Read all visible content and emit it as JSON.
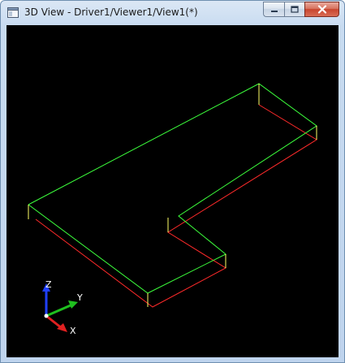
{
  "window": {
    "title": "3D View - Driver1/Viewer1/View1(*)",
    "buttons": [
      "minimize",
      "maximize",
      "close"
    ]
  },
  "viewport": {
    "background": "#000000",
    "edge_colors": {
      "top": "#3cff3c",
      "bottom": "#ff2a2a",
      "vertical": "#ffff66"
    }
  },
  "axis_triad": {
    "z_label": "Z",
    "y_label": "Y",
    "x_label": "X",
    "z_color": "#1f3fff",
    "y_color": "#1fbf1f",
    "x_color": "#e02020"
  }
}
